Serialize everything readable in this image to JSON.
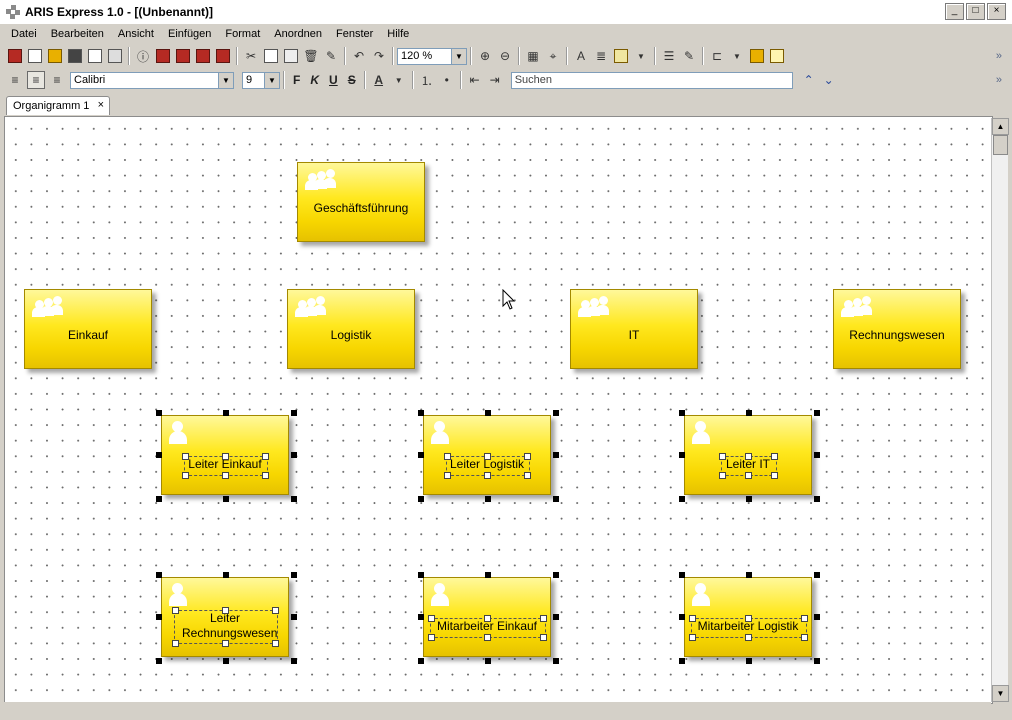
{
  "window": {
    "title": "ARIS Express 1.0 - [(Unbenannt)]",
    "controls": [
      "_",
      "□",
      "×"
    ]
  },
  "menu": [
    "Datei",
    "Bearbeiten",
    "Ansicht",
    "Einfügen",
    "Format",
    "Anordnen",
    "Fenster",
    "Hilfe"
  ],
  "toolbar": {
    "zoom": "120 %",
    "font": "Calibri",
    "font_size": "9",
    "bold": "F",
    "italic": "K",
    "underline": "U",
    "strike": "S",
    "search_placeholder": "Suchen",
    "overflow": "»"
  },
  "tabs": [
    {
      "label": "Organigramm 1",
      "close": "×"
    }
  ],
  "diagram": {
    "boxes": [
      {
        "id": "gf",
        "label": "Geschäftsführung",
        "icon": "group-icon"
      },
      {
        "id": "einkauf",
        "label": "Einkauf",
        "icon": "group-icon"
      },
      {
        "id": "logistik",
        "label": "Logistik",
        "icon": "group-icon"
      },
      {
        "id": "it",
        "label": "IT",
        "icon": "group-icon"
      },
      {
        "id": "rw",
        "label": "Rechnungswesen",
        "icon": "group-icon"
      },
      {
        "id": "le",
        "label": "Leiter Einkauf",
        "icon": "person-icon"
      },
      {
        "id": "ll",
        "label": "Leiter Logistik",
        "icon": "person-icon"
      },
      {
        "id": "lit",
        "label": "Leiter IT",
        "icon": "person-icon"
      },
      {
        "id": "lrw",
        "label": "Leiter Rechnungswesen",
        "icon": "person-icon"
      },
      {
        "id": "me",
        "label": "Mitarbeiter Einkauf",
        "icon": "person-icon"
      },
      {
        "id": "ml",
        "label": "Mitarbeiter Logistik",
        "icon": "person-icon"
      }
    ]
  },
  "colors": {
    "box_yellow": "#ffe81f",
    "box_border": "#a38900"
  }
}
